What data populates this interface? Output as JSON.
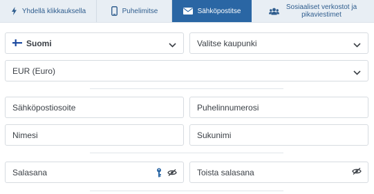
{
  "tabs": [
    {
      "label": "Yhdellä klikkauksella",
      "icon": "lightning-icon",
      "active": false
    },
    {
      "label": "Puhelimitse",
      "icon": "phone-icon",
      "active": false
    },
    {
      "label": "Sähköpostitse",
      "icon": "envelope-icon",
      "active": true
    },
    {
      "label_line1": "Sosiaaliset verkostot ja",
      "label_line2": "pikaviestimet",
      "icon": "users-icon",
      "active": false
    }
  ],
  "form": {
    "country": "Suomi",
    "city_placeholder": "Valitse kaupunki",
    "currency": "EUR (Euro)",
    "email_placeholder": "Sähköpostiosoite",
    "phone_placeholder": "Puhelinnumerosi",
    "name_placeholder": "Nimesi",
    "surname_placeholder": "Sukunimi",
    "password_placeholder": "Salasana",
    "repeat_password_placeholder": "Toista salasana"
  },
  "colors": {
    "accent": "#2a66a4",
    "tab_bg": "#e8eef4",
    "tab_text": "#2f5d8e",
    "flag_blue": "#1c4aa0"
  }
}
